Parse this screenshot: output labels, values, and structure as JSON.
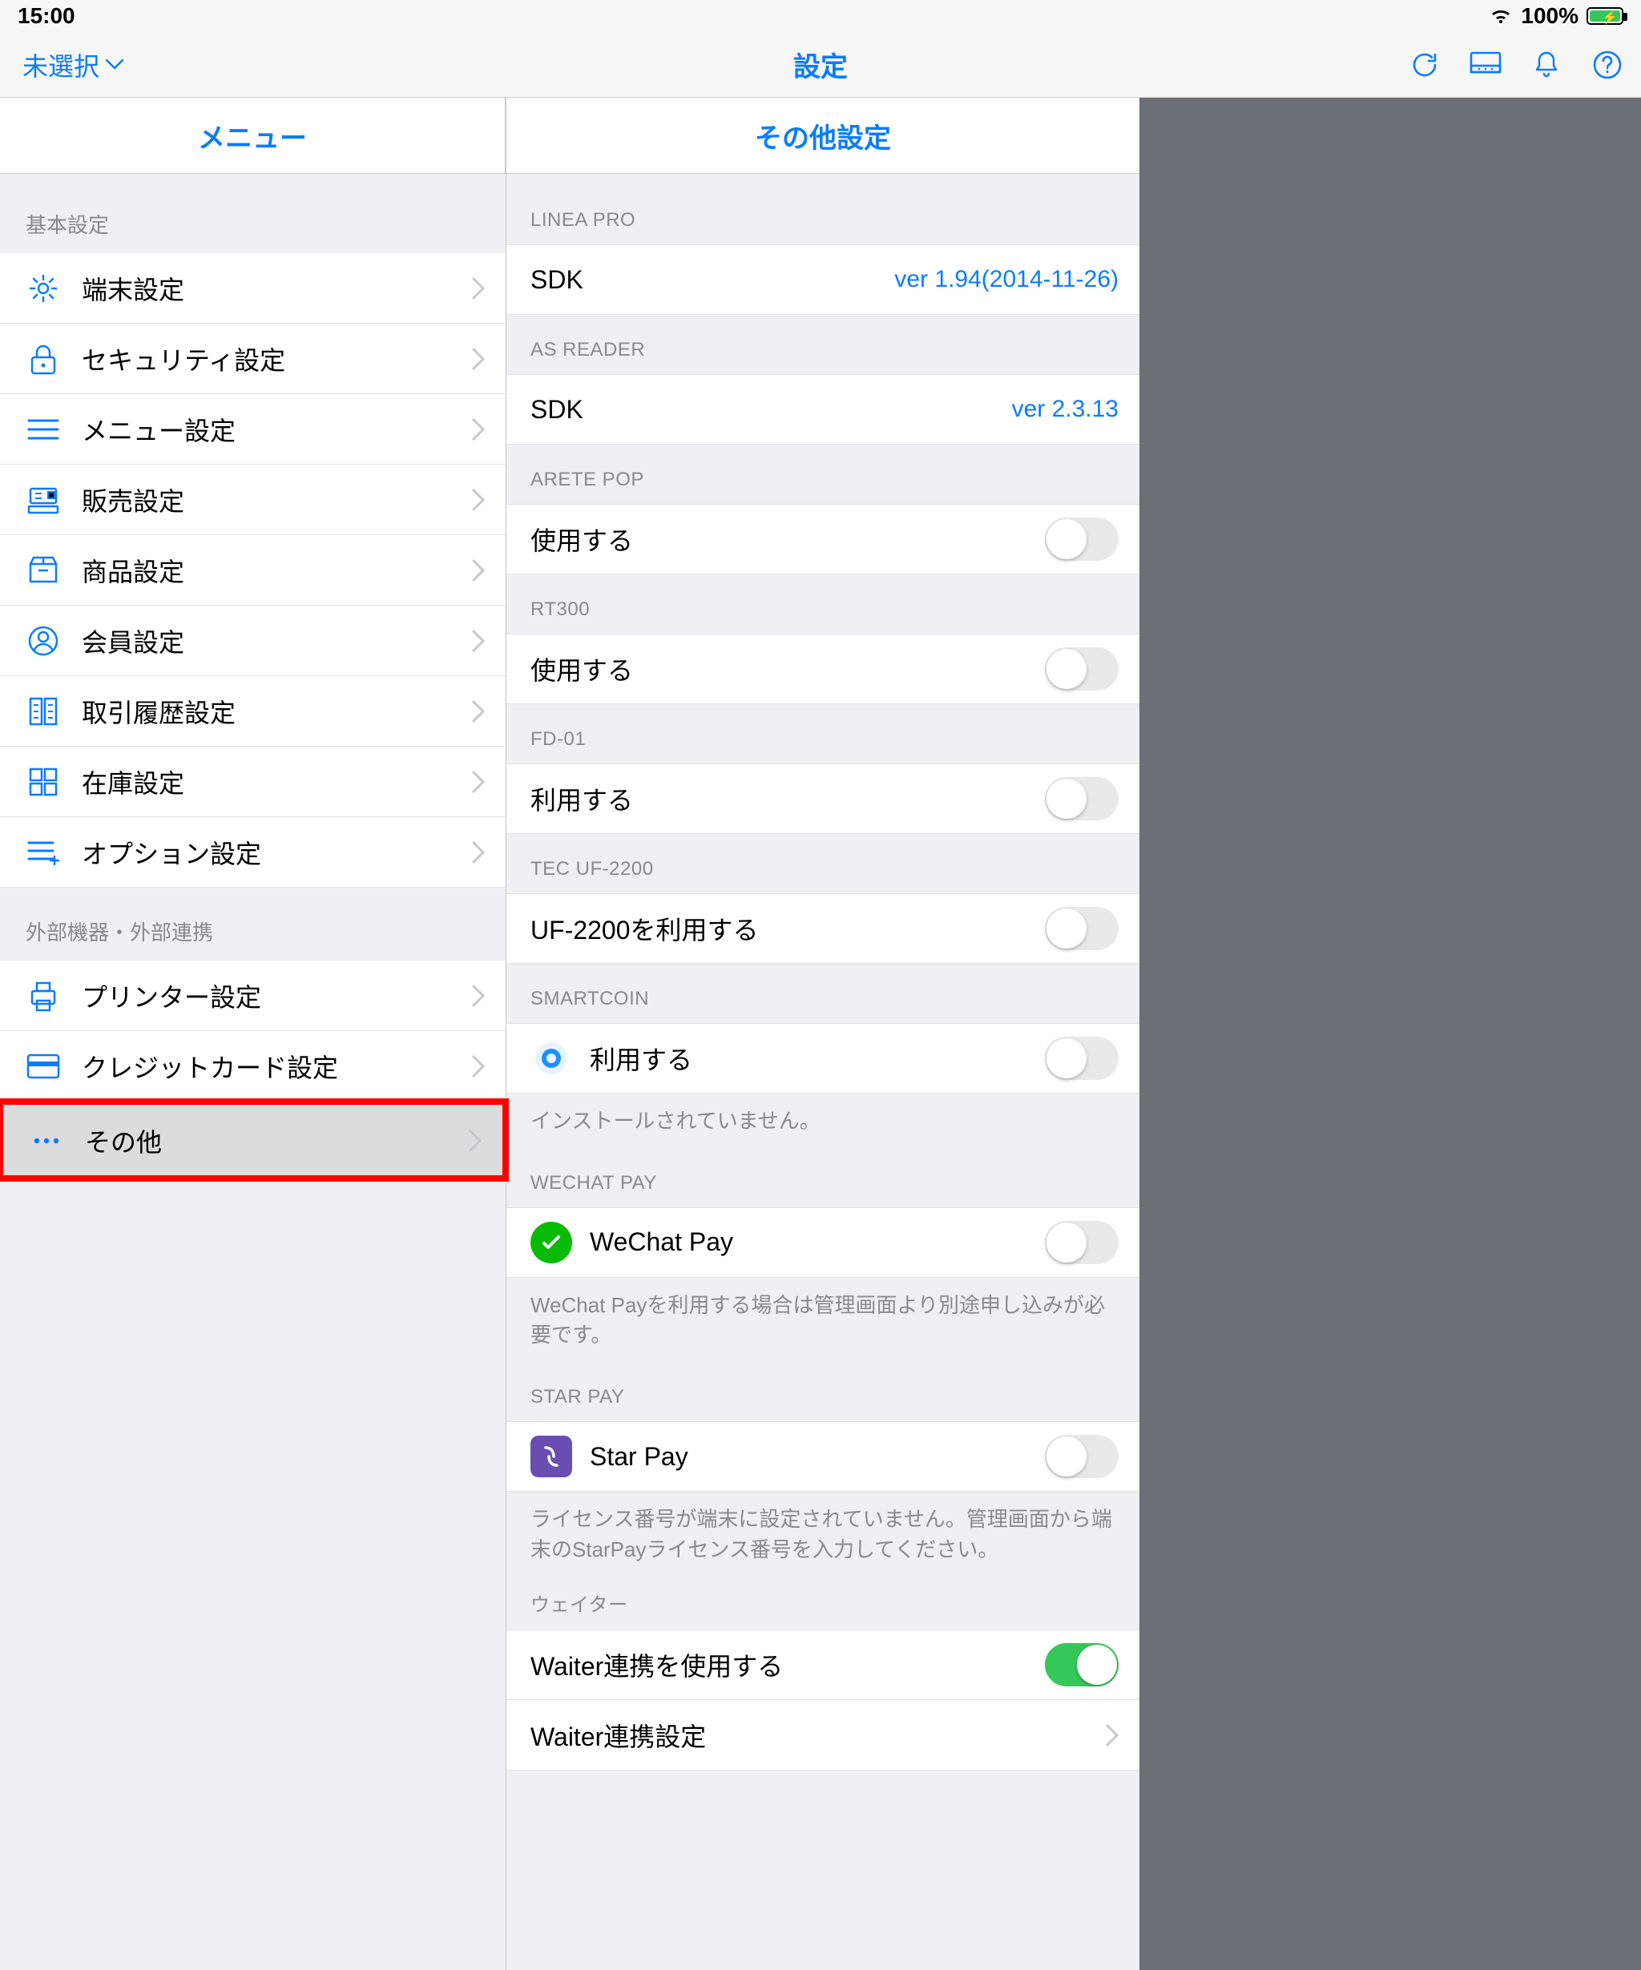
{
  "statusbar": {
    "time": "15:00",
    "battery_pct": "100%",
    "wifi": true,
    "charging": true
  },
  "navbar": {
    "left_text": "未選択",
    "title": "設定"
  },
  "sidebar": {
    "header": "メニュー",
    "section1_label": "基本設定",
    "section1_items": [
      {
        "label": "端末設定"
      },
      {
        "label": "セキュリティ設定"
      },
      {
        "label": "メニュー設定"
      },
      {
        "label": "販売設定"
      },
      {
        "label": "商品設定"
      },
      {
        "label": "会員設定"
      },
      {
        "label": "取引履歴設定"
      },
      {
        "label": "在庫設定"
      },
      {
        "label": "オプション設定"
      }
    ],
    "section2_label": "外部機器・外部連携",
    "section2_items": [
      {
        "label": "プリンター設定"
      },
      {
        "label": "クレジットカード設定"
      },
      {
        "label": "その他",
        "selected": true
      }
    ]
  },
  "main": {
    "header": "その他設定",
    "groups": {
      "linea_pro": {
        "label": "LINEA PRO",
        "row_label": "SDK",
        "row_value": "ver 1.94(2014-11-26)"
      },
      "as_reader": {
        "label": "AS READER",
        "row_label": "SDK",
        "row_value": "ver 2.3.13"
      },
      "arete_pop": {
        "label": "ARETE POP",
        "row_label": "使用する",
        "toggle": false
      },
      "rt300": {
        "label": "RT300",
        "row_label": "使用する",
        "toggle": false
      },
      "fd01": {
        "label": "FD-01",
        "row_label": "利用する",
        "toggle": false
      },
      "tec_uf2200": {
        "label": "TEC UF-2200",
        "row_label": "UF-2200を利用する",
        "toggle": false
      },
      "smartcoin": {
        "label": "SMARTCOIN",
        "row_label": "利用する",
        "toggle": false,
        "note": "インストールされていません。"
      },
      "wechatpay": {
        "label": "WECHAT PAY",
        "row_label": "WeChat Pay",
        "toggle": false,
        "note": "WeChat Payを利用する場合は管理画面より別途申し込みが必要です。"
      },
      "starpay": {
        "label": "STAR PAY",
        "row_label": "Star Pay",
        "toggle": false,
        "note": "ライセンス番号が端末に設定されていません。管理画面から端末のStarPayライセンス番号を入力してください。"
      },
      "waiter": {
        "label": "ウェイター",
        "row1_label": "Waiter連携を使用する",
        "row1_toggle": true,
        "row2_label": "Waiter連携設定"
      }
    }
  }
}
